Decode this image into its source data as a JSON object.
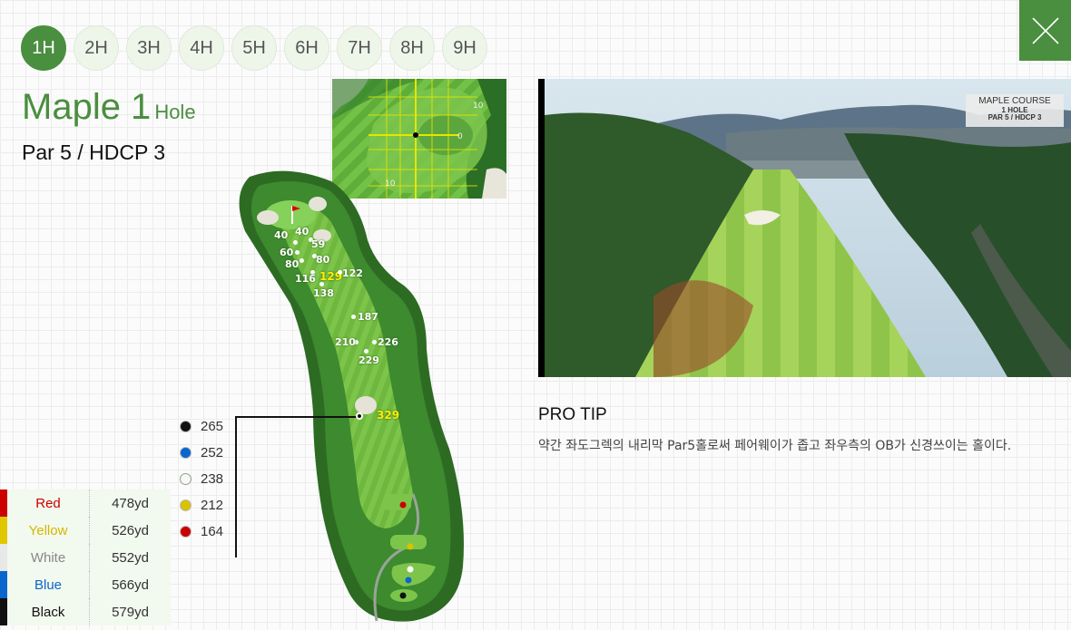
{
  "hole_tabs": [
    {
      "label": "1H",
      "active": true
    },
    {
      "label": "2H",
      "active": false
    },
    {
      "label": "3H",
      "active": false
    },
    {
      "label": "4H",
      "active": false
    },
    {
      "label": "5H",
      "active": false
    },
    {
      "label": "6H",
      "active": false
    },
    {
      "label": "7H",
      "active": false
    },
    {
      "label": "8H",
      "active": false
    },
    {
      "label": "9H",
      "active": false
    }
  ],
  "close_icon": "close-icon",
  "title": {
    "main": "Maple 1",
    "sub": "Hole",
    "par_line": "Par 5 / HDCP 3"
  },
  "green_inset": {
    "contour_labels": [
      "10",
      "0",
      "10"
    ]
  },
  "course_map": {
    "distances": [
      {
        "value": "40"
      },
      {
        "value": "40"
      },
      {
        "value": "59"
      },
      {
        "value": "60"
      },
      {
        "value": "80"
      },
      {
        "value": "80"
      },
      {
        "value": "116"
      },
      {
        "value": "129",
        "highlight": true
      },
      {
        "value": "122"
      },
      {
        "value": "138"
      },
      {
        "value": "187"
      },
      {
        "value": "210"
      },
      {
        "value": "226"
      },
      {
        "value": "229"
      },
      {
        "value": "329",
        "highlight": true
      }
    ]
  },
  "tee_distances": [
    {
      "color": "#111111",
      "value": "265"
    },
    {
      "color": "#0a66cc",
      "value": "252"
    },
    {
      "color": "#f4fbf2",
      "value": "238"
    },
    {
      "color": "#d9c200",
      "value": "212"
    },
    {
      "color": "#cc0000",
      "value": "164"
    }
  ],
  "tee_table": [
    {
      "name": "Red",
      "yards": "478yd",
      "color": "#cc0000",
      "text_color": "#cc0000"
    },
    {
      "name": "Yellow",
      "yards": "526yd",
      "color": "#e0c800",
      "text_color": "#d4b800"
    },
    {
      "name": "White",
      "yards": "552yd",
      "color": "#e8e8e8",
      "text_color": "#888888"
    },
    {
      "name": "Blue",
      "yards": "566yd",
      "color": "#0a66cc",
      "text_color": "#0a66cc"
    },
    {
      "name": "Black",
      "yards": "579yd",
      "color": "#111111",
      "text_color": "#111111"
    }
  ],
  "photo": {
    "badge_line1": "MAPLE COURSE",
    "badge_line2": "1 HOLE",
    "badge_line3": "PAR 5 / HDCP 3"
  },
  "pro_tip": {
    "title": "PRO TIP",
    "text": "약간 좌도그렉의 내리막 Par5홀로써 페어웨이가 좁고 좌우측의 OB가 신경쓰이는 홀이다."
  },
  "colors": {
    "accent": "#4a8e3f"
  }
}
